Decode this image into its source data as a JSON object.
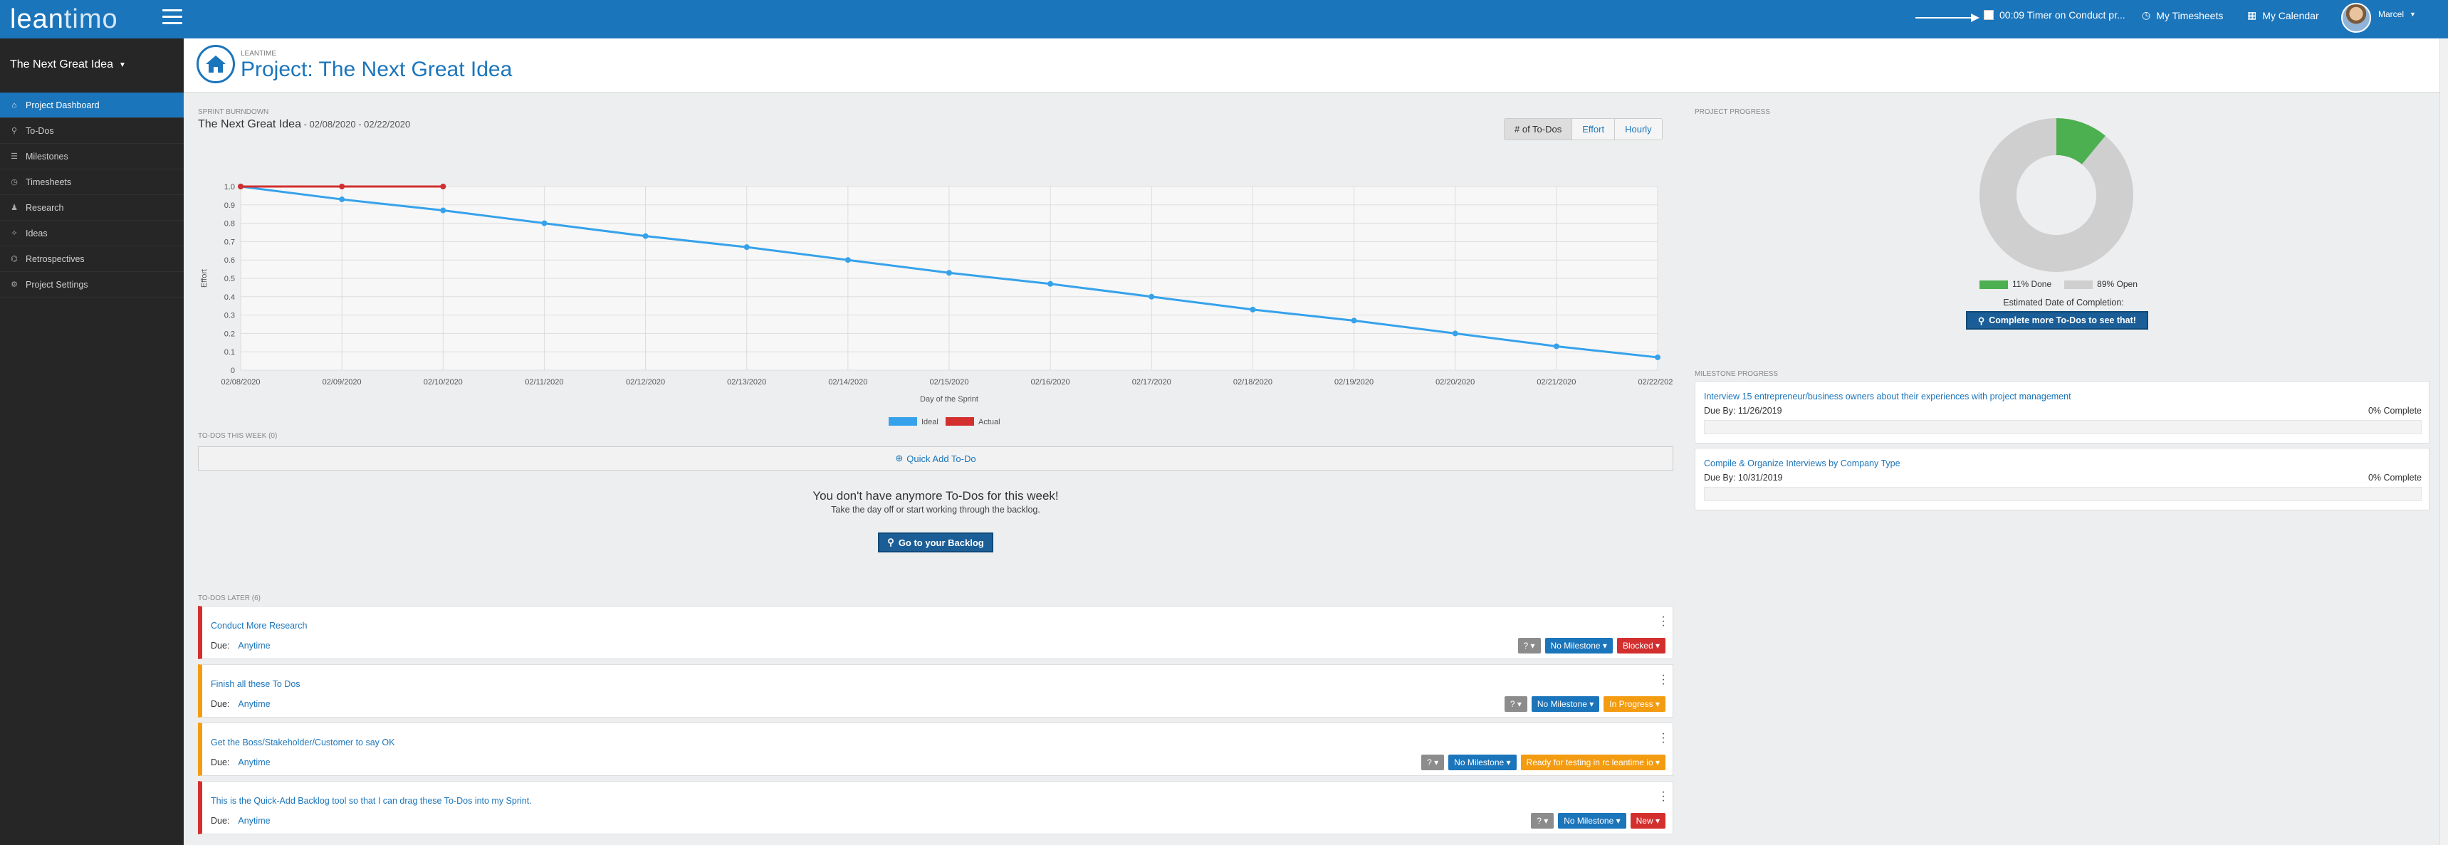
{
  "app": {
    "logo_prefix": "lean",
    "logo_suffix": "timo"
  },
  "header": {
    "timer_text": "00:09 Timer on Conduct pr...",
    "my_timesheets": "My Timesheets",
    "my_calendar": "My Calendar",
    "user_name": "Marcel"
  },
  "sidebar": {
    "project_name": "The Next Great Idea",
    "items": [
      {
        "label": "Project Dashboard",
        "icon": "home-icon",
        "glyph": "⌂"
      },
      {
        "label": "To-Dos",
        "icon": "pin-icon",
        "glyph": "⚲"
      },
      {
        "label": "Milestones",
        "icon": "sliders-icon",
        "glyph": "☰"
      },
      {
        "label": "Timesheets",
        "icon": "clock-icon",
        "glyph": "◷"
      },
      {
        "label": "Research",
        "icon": "user-icon",
        "glyph": "♟"
      },
      {
        "label": "Ideas",
        "icon": "lightbulb-icon",
        "glyph": "✧"
      },
      {
        "label": "Retrospectives",
        "icon": "binoculars-icon",
        "glyph": "⌬"
      },
      {
        "label": "Project Settings",
        "icon": "gear-icon",
        "glyph": "⚙"
      }
    ]
  },
  "page": {
    "crumb": "LEANTIME",
    "title": "Project: The Next Great Idea"
  },
  "burndown": {
    "section_label": "SPRINT BURNDOWN",
    "sprint_name": "The Next Great Idea",
    "date_range": " - 02/08/2020 - 02/22/2020",
    "buttons": [
      "# of To-Dos",
      "Effort",
      "Hourly"
    ]
  },
  "chart_data": {
    "type": "line",
    "x": [
      "02/08/2020",
      "02/09/2020",
      "02/10/2020",
      "02/11/2020",
      "02/12/2020",
      "02/13/2020",
      "02/14/2020",
      "02/15/2020",
      "02/16/2020",
      "02/17/2020",
      "02/18/2020",
      "02/19/2020",
      "02/20/2020",
      "02/21/2020",
      "02/22/2020"
    ],
    "series": [
      {
        "name": "Ideal",
        "color": "#36a2eb",
        "values": [
          1.0,
          0.93,
          0.87,
          0.8,
          0.73,
          0.67,
          0.6,
          0.53,
          0.47,
          0.4,
          0.33,
          0.27,
          0.2,
          0.13,
          0.07
        ]
      },
      {
        "name": "Actual",
        "color": "#d32f2f",
        "values": [
          1.0,
          1.0,
          1.0
        ]
      }
    ],
    "xlabel": "Day of the Sprint",
    "ylabel": "Effort",
    "ylim": [
      0,
      1.0
    ],
    "yticks": [
      "0",
      "0.1",
      "0.2",
      "0.3",
      "0.4",
      "0.5",
      "0.6",
      "0.7",
      "0.8",
      "0.9",
      "1.0"
    ],
    "grid": true,
    "legend": "bottom"
  },
  "todos_week": {
    "section_label": "TO-DOS THIS WEEK (0)",
    "quick_add": "Quick Add To-Do",
    "empty_heading": "You don't have anymore To-Dos for this week!",
    "empty_sub": "Take the day off or start working through the backlog.",
    "backlog_button": "Go to your Backlog"
  },
  "todos_later": {
    "section_label": "TO-DOS LATER (6)",
    "due_label": "Due:",
    "items": [
      {
        "title": "Conduct More Research",
        "due": "Anytime",
        "effort": "?",
        "milestone": "No Milestone",
        "status": "Blocked",
        "status_color": "red",
        "border_color": "#d32f2f"
      },
      {
        "title": "Finish all these To Dos",
        "due": "Anytime",
        "effort": "?",
        "milestone": "No Milestone",
        "status": "In Progress",
        "status_color": "orange",
        "border_color": "#f39c12"
      },
      {
        "title": "Get the Boss/Stakeholder/Customer to say OK",
        "due": "Anytime",
        "effort": "?",
        "milestone": "No Milestone",
        "status": "Ready for testing in rc leantime io",
        "status_color": "orange",
        "border_color": "#f39c12"
      },
      {
        "title": "This is the Quick-Add Backlog tool so that I can drag these To-Dos into my Sprint.",
        "due": "Anytime",
        "effort": "?",
        "milestone": "No Milestone",
        "status": "New",
        "status_color": "red",
        "border_color": "#d32f2f"
      }
    ]
  },
  "project_progress": {
    "section_label": "PROJECT PROGRESS",
    "done_pct": 11,
    "open_pct": 89,
    "done_label": "11% Done",
    "open_label": "89% Open",
    "done_color": "#4caf50",
    "open_color": "#cfcfcf",
    "estimated_label": "Estimated Date of Completion:",
    "complete_button": "Complete more To-Dos to see that!"
  },
  "milestone_progress": {
    "section_label": "MILESTONE PROGRESS",
    "items": [
      {
        "title": "Interview 15 entrepreneur/business owners about their experiences with project management",
        "due": "Due By: 11/26/2019",
        "pct": "0% Complete"
      },
      {
        "title": "Compile & Organize Interviews by Company Type",
        "due": "Due By: 10/31/2019",
        "pct": "0% Complete"
      }
    ]
  }
}
